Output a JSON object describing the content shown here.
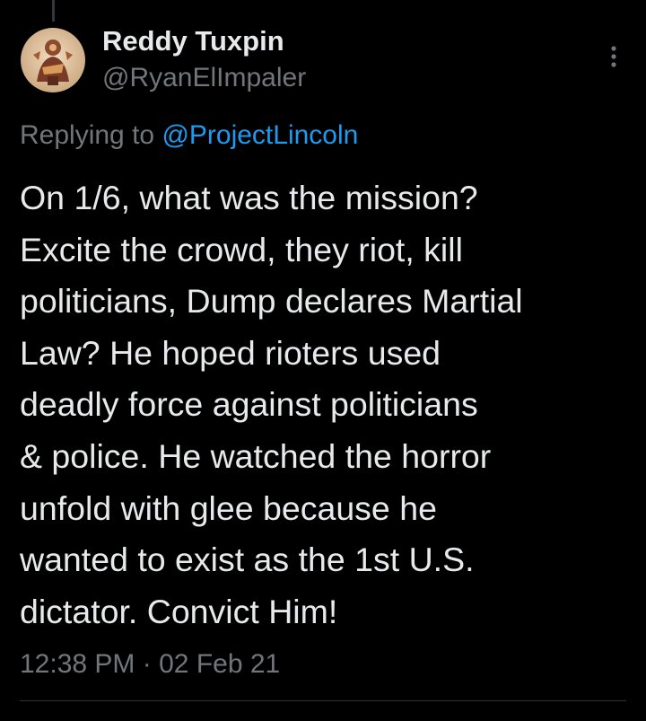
{
  "author": {
    "display_name": "Reddy Tuxpin",
    "handle": "@RyanElImpaler",
    "avatar_icon": "profile-avatar"
  },
  "reply": {
    "label": "Replying to",
    "mention": "@ProjectLincoln"
  },
  "tweet": {
    "lines": [
      "On 1/6, what was the mission?",
      "Excite the crowd, they riot, kill",
      "politicians, Dump declares Martial",
      "Law? He hoped rioters used",
      "deadly force against politicians",
      "& police. He watched the horror",
      "unfold with glee because he",
      "wanted to exist as the 1st U.S.",
      "dictator. Convict Him!"
    ]
  },
  "meta": {
    "time": "12:38 PM",
    "separator": "·",
    "date": "02 Feb 21"
  },
  "colors": {
    "background": "#000000",
    "text_primary": "#e7e9ea",
    "text_secondary": "#71767b",
    "link": "#1d9bf0"
  }
}
